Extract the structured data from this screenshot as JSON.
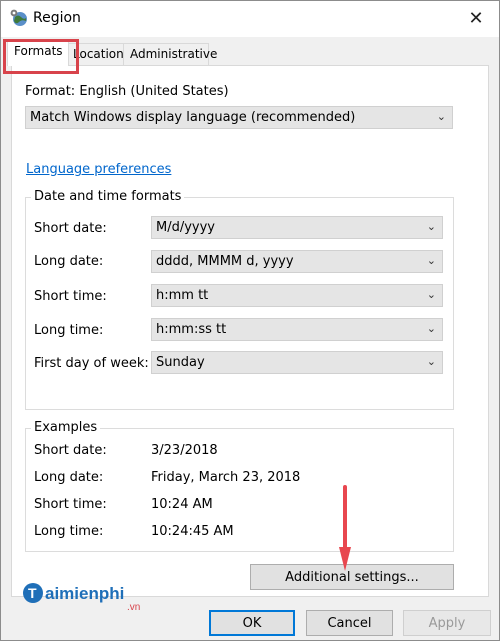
{
  "window": {
    "title": "Region",
    "close_glyph": "✕"
  },
  "tabs": [
    {
      "label": "Formats",
      "active": true
    },
    {
      "label": "Location",
      "active": false
    },
    {
      "label": "Administrative",
      "active": false
    }
  ],
  "format": {
    "label": "Format: English (United States)",
    "select_value": "Match Windows display language (recommended)"
  },
  "language_link": "Language preferences",
  "date_time": {
    "title": "Date and time formats",
    "rows": [
      {
        "label": "Short date:",
        "value": "M/d/yyyy"
      },
      {
        "label": "Long date:",
        "value": "dddd, MMMM d, yyyy"
      },
      {
        "label": "Short time:",
        "value": "h:mm tt"
      },
      {
        "label": "Long time:",
        "value": "h:mm:ss tt"
      },
      {
        "label": "First day of week:",
        "value": "Sunday"
      }
    ]
  },
  "examples": {
    "title": "Examples",
    "rows": [
      {
        "label": "Short date:",
        "value": "3/23/2018"
      },
      {
        "label": "Long date:",
        "value": "Friday, March 23, 2018"
      },
      {
        "label": "Short time:",
        "value": "10:24 AM"
      },
      {
        "label": "Long time:",
        "value": "10:24:45 AM"
      }
    ]
  },
  "additional_settings": "Additional settings...",
  "buttons": {
    "ok": "OK",
    "cancel": "Cancel",
    "apply": "Apply"
  },
  "watermark": {
    "name": "Taimienphi",
    "suffix": ".vn"
  },
  "colors": {
    "highlight": "#d8434b",
    "link": "#0066cc",
    "arrow": "#e8474f"
  },
  "icons": {
    "close": "close-icon",
    "chevron": "chevron-down-icon",
    "app": "region-globe-icon"
  }
}
